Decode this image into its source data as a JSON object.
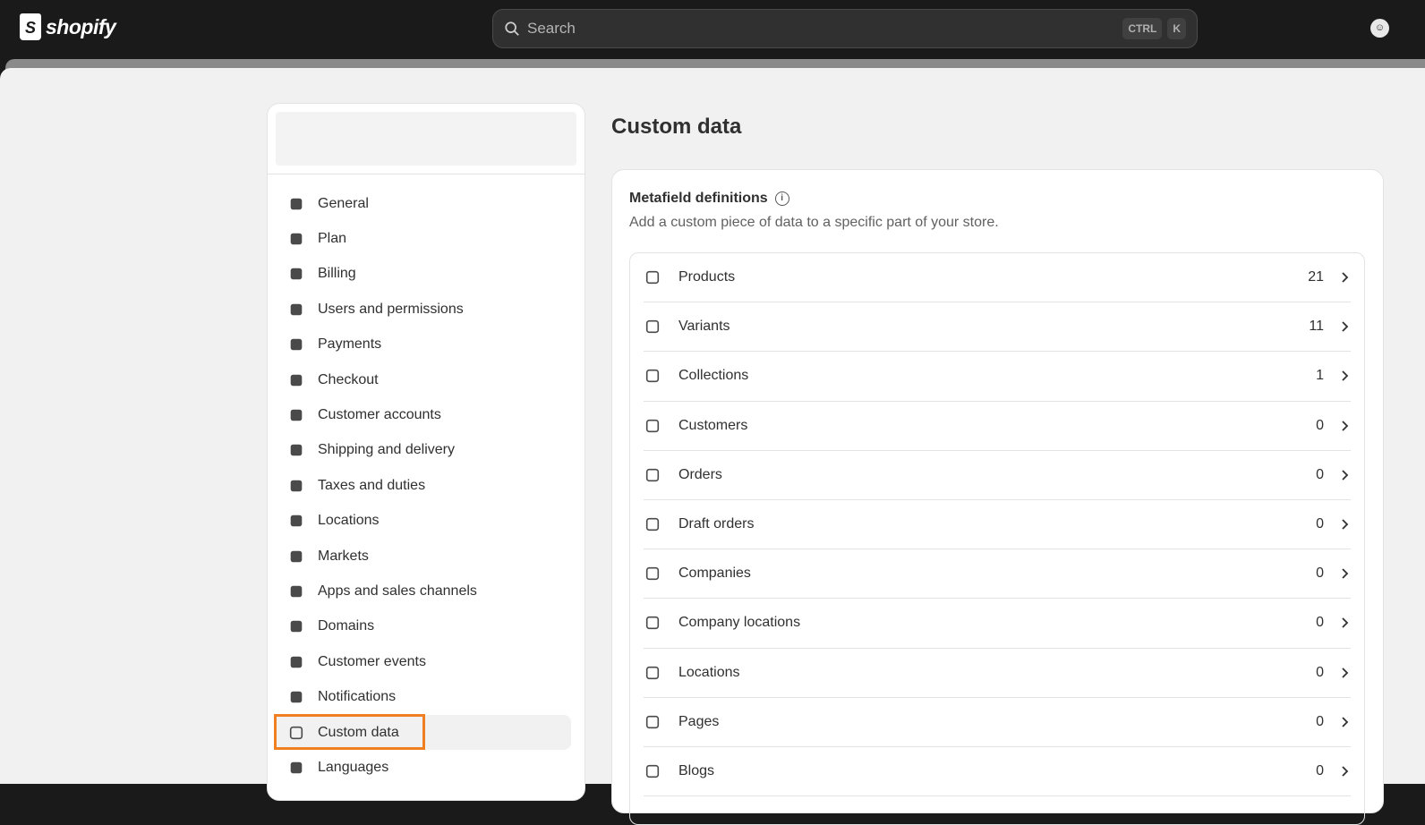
{
  "topbar": {
    "brand": "shopify",
    "search_placeholder": "Search",
    "shortcut": [
      "CTRL",
      "K"
    ],
    "avatar": "☺"
  },
  "sidebar": {
    "items": [
      {
        "label": "General",
        "icon": "store-icon"
      },
      {
        "label": "Plan",
        "icon": "plan-icon"
      },
      {
        "label": "Billing",
        "icon": "billing-icon"
      },
      {
        "label": "Users and permissions",
        "icon": "users-icon"
      },
      {
        "label": "Payments",
        "icon": "payments-icon"
      },
      {
        "label": "Checkout",
        "icon": "cart-icon"
      },
      {
        "label": "Customer accounts",
        "icon": "person-icon"
      },
      {
        "label": "Shipping and delivery",
        "icon": "truck-icon"
      },
      {
        "label": "Taxes and duties",
        "icon": "tax-icon"
      },
      {
        "label": "Locations",
        "icon": "location-icon"
      },
      {
        "label": "Markets",
        "icon": "globe-icon"
      },
      {
        "label": "Apps and sales channels",
        "icon": "apps-icon"
      },
      {
        "label": "Domains",
        "icon": "domain-icon"
      },
      {
        "label": "Customer events",
        "icon": "cursor-click-icon"
      },
      {
        "label": "Notifications",
        "icon": "bell-icon"
      },
      {
        "label": "Custom data",
        "icon": "custom-data-icon",
        "active": true
      },
      {
        "label": "Languages",
        "icon": "language-icon"
      }
    ]
  },
  "page": {
    "title": "Custom data"
  },
  "metafields": {
    "title": "Metafield definitions",
    "subtitle": "Add a custom piece of data to a specific part of your store.",
    "rows": [
      {
        "label": "Products",
        "count": "21",
        "icon": "tag-icon"
      },
      {
        "label": "Variants",
        "count": "11",
        "icon": "variant-icon"
      },
      {
        "label": "Collections",
        "count": "1",
        "icon": "collection-icon"
      },
      {
        "label": "Customers",
        "count": "0",
        "icon": "person-icon"
      },
      {
        "label": "Orders",
        "count": "0",
        "icon": "inbox-icon"
      },
      {
        "label": "Draft orders",
        "count": "0",
        "icon": "draft-order-icon"
      },
      {
        "label": "Companies",
        "count": "0",
        "icon": "briefcase-icon"
      },
      {
        "label": "Company locations",
        "count": "0",
        "icon": "building-icon"
      },
      {
        "label": "Locations",
        "count": "0",
        "icon": "location-pin-icon"
      },
      {
        "label": "Pages",
        "count": "0",
        "icon": "page-icon"
      },
      {
        "label": "Blogs",
        "count": "0",
        "icon": "blog-icon"
      }
    ]
  }
}
